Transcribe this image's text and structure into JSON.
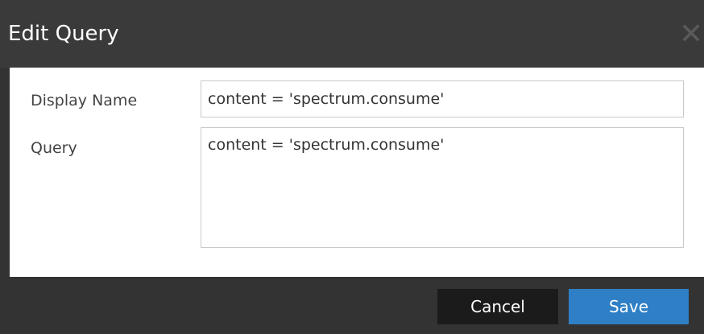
{
  "dialog": {
    "title": "Edit Query",
    "close_glyph": "✕",
    "close_icon": "close-icon"
  },
  "form": {
    "display_name": {
      "label": "Display Name",
      "value": "content = 'spectrum.consume'"
    },
    "query": {
      "label": "Query",
      "value": "content = 'spectrum.consume'"
    }
  },
  "buttons": {
    "cancel_label": "Cancel",
    "save_label": "Save"
  },
  "colors": {
    "title_bar": "#3a3a3a",
    "footer": "#333333",
    "cancel_button": "#1b1b1b",
    "save_button": "#2e7fc5",
    "field_border": "#c9c9c9"
  }
}
